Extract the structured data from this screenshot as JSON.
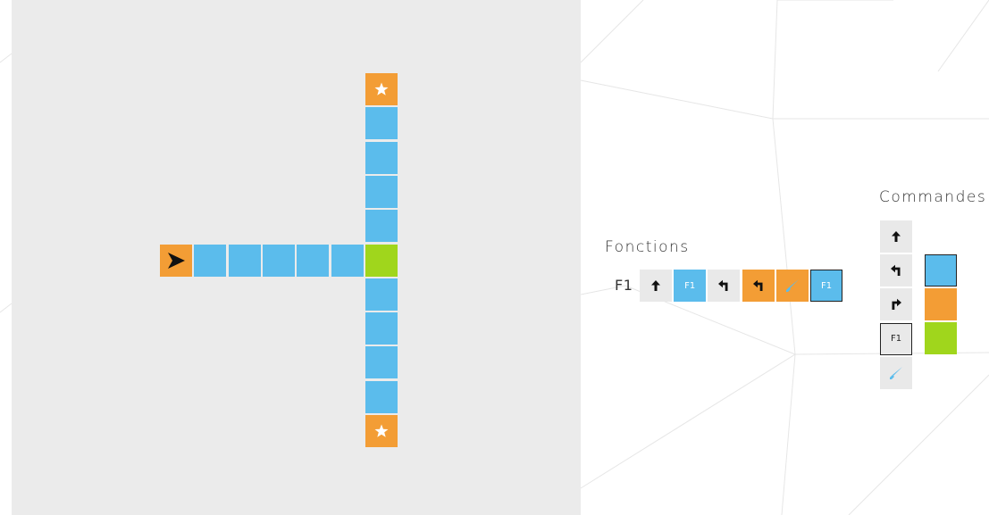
{
  "colors": {
    "blue": "#5bbcec",
    "orange": "#f39d35",
    "green": "#a0d61c",
    "board": "#ebebeb",
    "slot_empty": "#e9e9e9"
  },
  "board": {
    "cells": [
      {
        "col": 0,
        "row": 5,
        "color": "orange",
        "icon": "robot-arrow-icon"
      },
      {
        "col": 1,
        "row": 5,
        "color": "blue"
      },
      {
        "col": 2,
        "row": 5,
        "color": "blue"
      },
      {
        "col": 3,
        "row": 5,
        "color": "blue"
      },
      {
        "col": 4,
        "row": 5,
        "color": "blue"
      },
      {
        "col": 5,
        "row": 5,
        "color": "blue"
      },
      {
        "col": 6,
        "row": 5,
        "color": "green"
      },
      {
        "col": 6,
        "row": 0,
        "color": "orange",
        "icon": "star-icon"
      },
      {
        "col": 6,
        "row": 1,
        "color": "blue"
      },
      {
        "col": 6,
        "row": 2,
        "color": "blue"
      },
      {
        "col": 6,
        "row": 3,
        "color": "blue"
      },
      {
        "col": 6,
        "row": 4,
        "color": "blue"
      },
      {
        "col": 6,
        "row": 6,
        "color": "blue"
      },
      {
        "col": 6,
        "row": 7,
        "color": "blue"
      },
      {
        "col": 6,
        "row": 8,
        "color": "blue"
      },
      {
        "col": 6,
        "row": 9,
        "color": "blue"
      },
      {
        "col": 6,
        "row": 10,
        "color": "orange",
        "icon": "star-icon"
      }
    ]
  },
  "functions": {
    "title": "Fonctions",
    "rows": [
      {
        "name": "F1",
        "slots": [
          {
            "icon": "forward-arrow-icon",
            "color": "grey",
            "label": ""
          },
          {
            "icon": "",
            "color": "blue",
            "label": "F1"
          },
          {
            "icon": "turn-left-icon",
            "color": "grey",
            "label": ""
          },
          {
            "icon": "turn-left-icon",
            "color": "orange",
            "label": ""
          },
          {
            "icon": "paint-brush-icon",
            "color": "orange",
            "label": ""
          },
          {
            "icon": "",
            "color": "blue",
            "label": "F1",
            "selected": true
          }
        ]
      }
    ]
  },
  "commands": {
    "title": "Commandes",
    "actions": [
      {
        "name": "forward-command",
        "icon": "forward-arrow-icon",
        "label": ""
      },
      {
        "name": "turn-left-command",
        "icon": "turn-left-icon",
        "label": ""
      },
      {
        "name": "turn-right-command",
        "icon": "turn-right-icon",
        "label": ""
      },
      {
        "name": "f1-command",
        "icon": "",
        "label": "F1",
        "selected": true
      },
      {
        "name": "paint-command",
        "icon": "paint-brush-icon",
        "label": ""
      }
    ],
    "colors": [
      {
        "name": "color-blue",
        "color": "blue",
        "selected": true
      },
      {
        "name": "color-orange",
        "color": "orange"
      },
      {
        "name": "color-green",
        "color": "green"
      }
    ]
  }
}
